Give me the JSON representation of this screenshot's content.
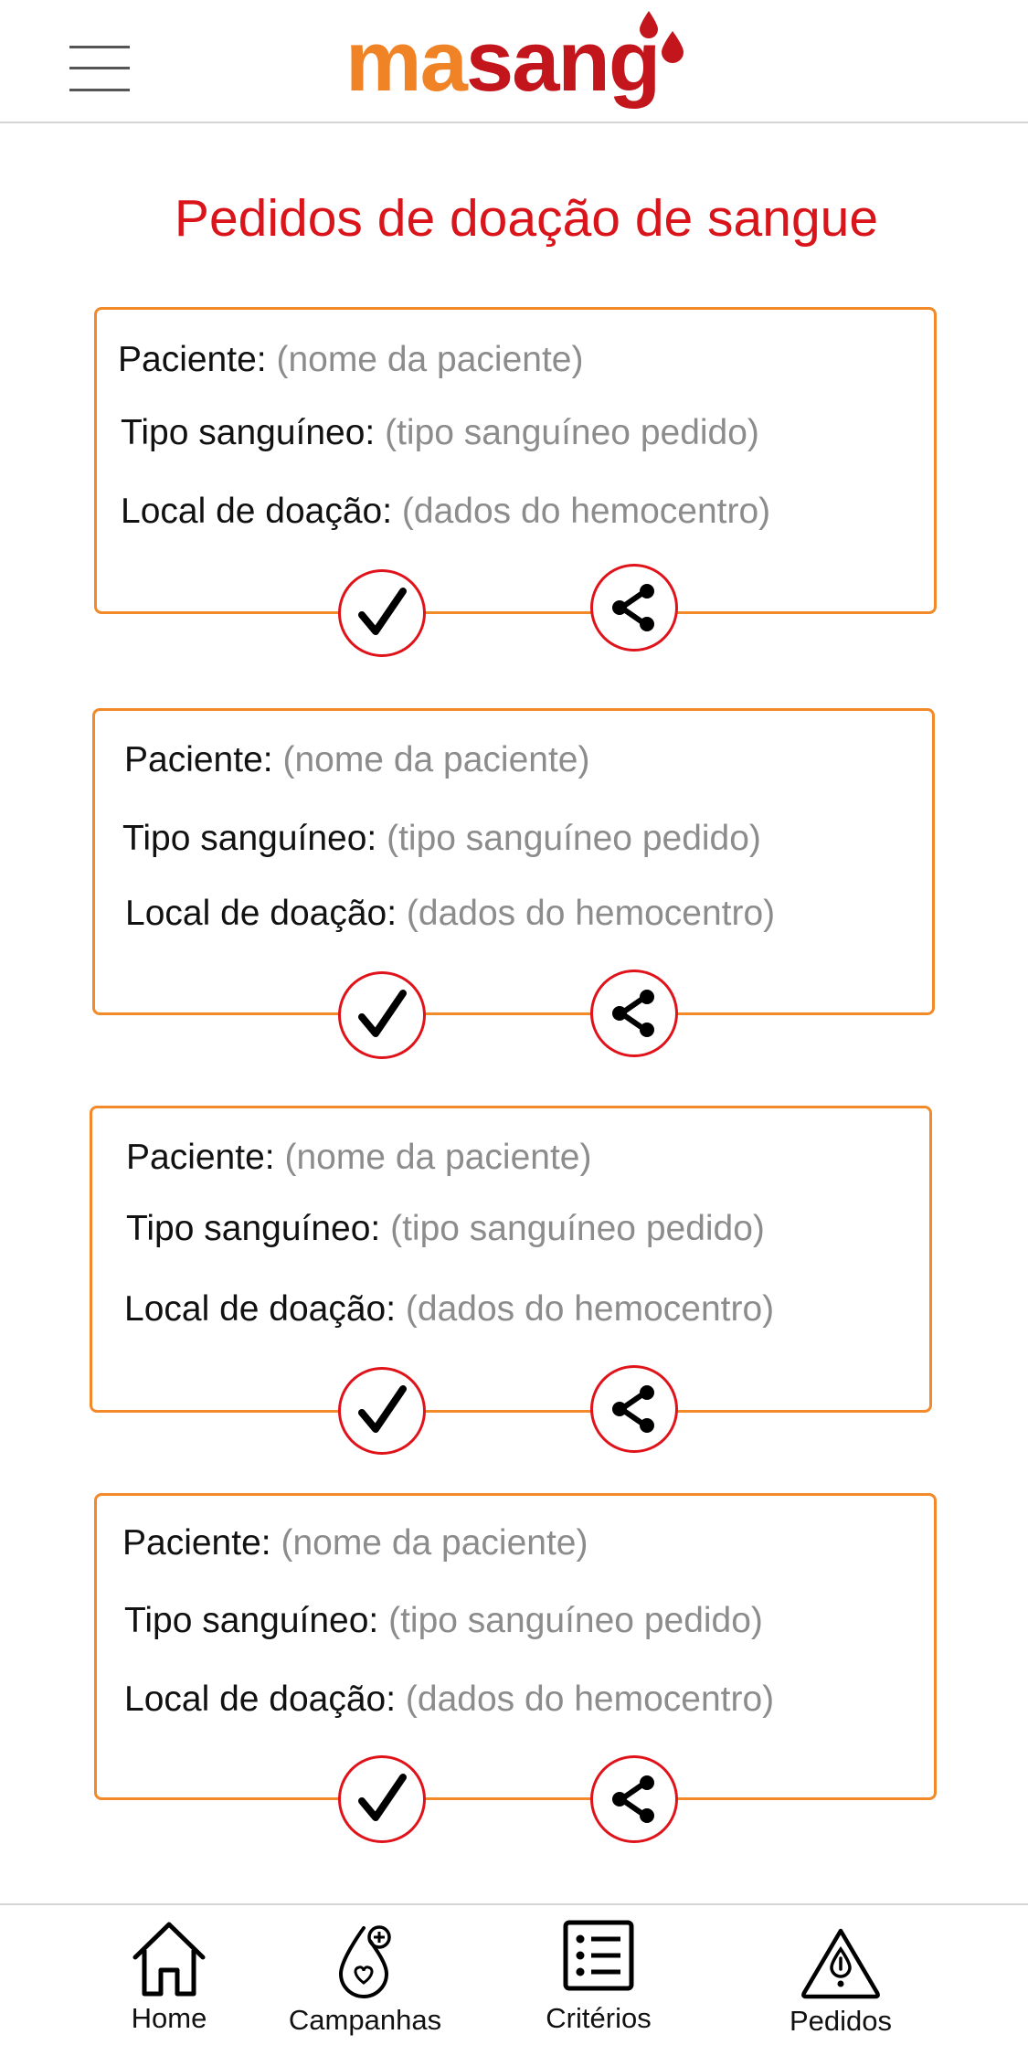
{
  "app": {
    "logo_part1": "ma",
    "logo_part2": "sang",
    "brand_orange": "#f08326",
    "brand_red": "#c3161c",
    "menu_icon": "hamburger-menu-icon"
  },
  "page": {
    "title": "Pedidos de doação de sangue"
  },
  "requests": [
    {
      "patient_label": "Paciente:",
      "patient_value": "(nome da paciente)",
      "blood_label": "Tipo sanguíneo:",
      "blood_value": "(tipo sanguíneo pedido)",
      "location_label": "Local de doação:",
      "location_value": "(dados do hemocentro)"
    },
    {
      "patient_label": "Paciente:",
      "patient_value": "(nome da paciente)",
      "blood_label": "Tipo sanguíneo:",
      "blood_value": "(tipo sanguíneo pedido)",
      "location_label": "Local de doação:",
      "location_value": "(dados do hemocentro)"
    },
    {
      "patient_label": "Paciente:",
      "patient_value": "(nome da paciente)",
      "blood_label": "Tipo sanguíneo:",
      "blood_value": "(tipo sanguíneo pedido)",
      "location_label": "Local de doação:",
      "location_value": "(dados do hemocentro)"
    },
    {
      "patient_label": "Paciente:",
      "patient_value": "(nome da paciente)",
      "blood_label": "Tipo sanguíneo:",
      "blood_value": "(tipo sanguíneo pedido)",
      "location_label": "Local de doação:",
      "location_value": "(dados do hemocentro)"
    }
  ],
  "card_actions": {
    "confirm_icon": "checkmark-icon",
    "share_icon": "share-icon",
    "border_color": "#f28a2a",
    "button_border_color": "#e0121a"
  },
  "bottom_nav": {
    "items": [
      {
        "label": "Home",
        "icon": "home-icon"
      },
      {
        "label": "Campanhas",
        "icon": "blood-drop-heart-icon"
      },
      {
        "label": "Critérios",
        "icon": "checklist-icon"
      },
      {
        "label": "Pedidos",
        "icon": "warning-drop-icon"
      }
    ]
  }
}
